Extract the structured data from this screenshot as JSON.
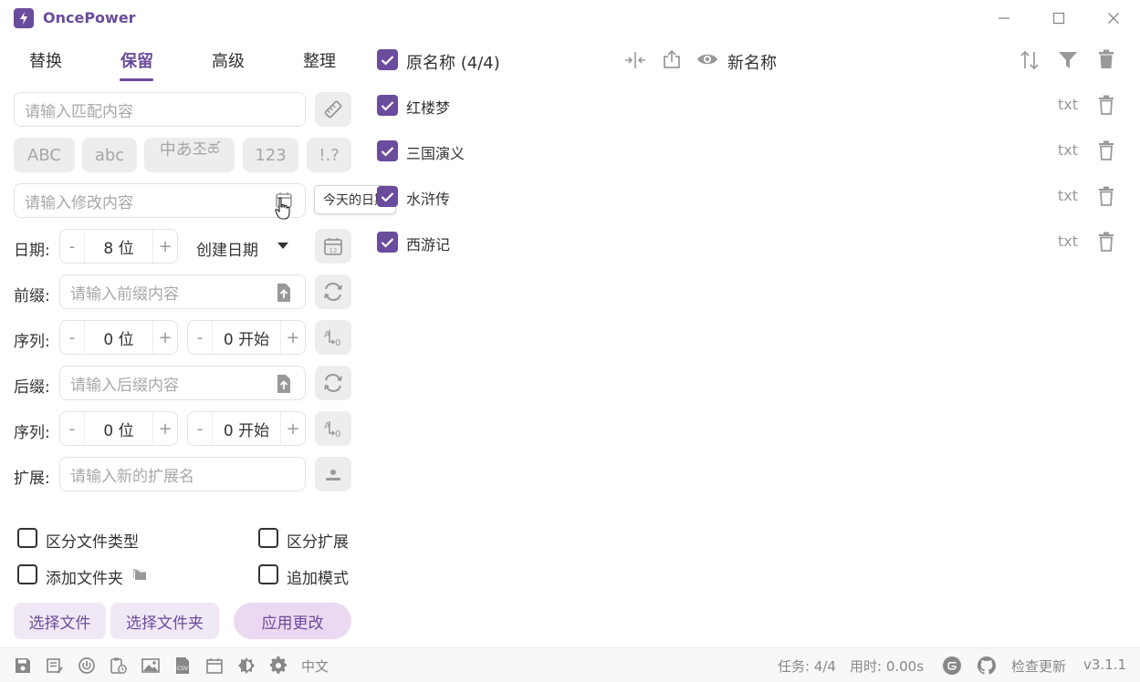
{
  "app": {
    "title": "OncePower"
  },
  "tabs": [
    "替换",
    "保留",
    "高级",
    "整理"
  ],
  "match": {
    "placeholder": "请输入匹配内容"
  },
  "chips": [
    "ABC",
    "abc",
    "中あ조ཚ",
    "123",
    "!.?"
  ],
  "modify": {
    "placeholder": "请输入修改内容",
    "tooltip": "今天的日期"
  },
  "date": {
    "label": "日期:",
    "digits": "8 位",
    "type": "创建日期",
    "minus": "-",
    "plus": "+"
  },
  "prefix": {
    "label": "前缀:",
    "placeholder": "请输入前缀内容"
  },
  "seq1": {
    "label": "序列:",
    "digits": "0 位",
    "start": "0 开始"
  },
  "suffix": {
    "label": "后缀:",
    "placeholder": "请输入后缀内容"
  },
  "seq2": {
    "label": "序列:",
    "digits": "0 位",
    "start": "0 开始"
  },
  "ext": {
    "label": "扩展:",
    "placeholder": "请输入新的扩展名"
  },
  "options": {
    "distinguish_type": "区分文件类型",
    "distinguish_ext": "区分扩展",
    "add_folder": "添加文件夹",
    "append_mode": "追加模式"
  },
  "buttons": {
    "select_files": "选择文件",
    "select_folder": "选择文件夹",
    "apply": "应用更改"
  },
  "list": {
    "original_header": "原名称 (4/4)",
    "new_header": "新名称",
    "files": [
      {
        "name": "红楼梦",
        "ext": "txt",
        "checked": true
      },
      {
        "name": "三国演义",
        "ext": "txt",
        "checked": true
      },
      {
        "name": "水浒传",
        "ext": "txt",
        "checked": true
      },
      {
        "name": "西游记",
        "ext": "txt",
        "checked": true
      }
    ]
  },
  "status": {
    "lang": "中文",
    "task": "任务: 4/4",
    "time": "用时: 0.00s",
    "update": "检查更新",
    "version": "v3.1.1"
  },
  "colors": {
    "accent": "#6a4c9c",
    "chip_bg": "#ededed",
    "button_bg": "#f1e8f6"
  }
}
